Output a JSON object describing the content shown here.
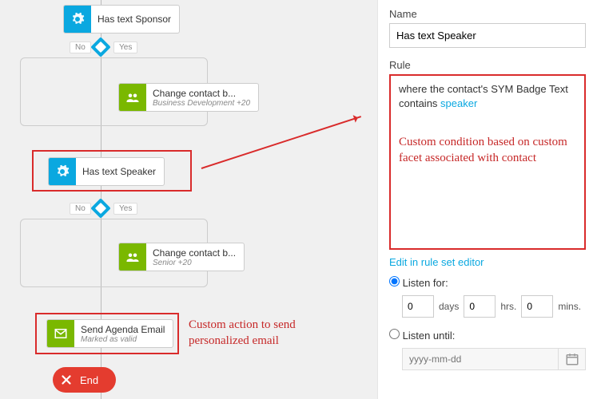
{
  "flow": {
    "sponsor": {
      "title": "Has text Sponsor"
    },
    "dec1": {
      "no": "No",
      "yes": "Yes"
    },
    "change1": {
      "title": "Change contact b...",
      "sub": "Business Development +20"
    },
    "speaker": {
      "title": "Has text Speaker"
    },
    "dec2": {
      "no": "No",
      "yes": "Yes"
    },
    "change2": {
      "title": "Change contact b...",
      "sub": "Senior +20"
    },
    "agenda": {
      "title": "Send Agenda Email",
      "sub": "Marked as valid"
    },
    "end": {
      "title": "End"
    }
  },
  "annotations": {
    "action": "Custom action to send personalized email",
    "condition": "Custom condition based on custom facet associated with contact"
  },
  "panel": {
    "name_label": "Name",
    "name_value": "Has text Speaker",
    "rule_label": "Rule",
    "rule_text_prefix": "where the contact's SYM Badge Text contains ",
    "rule_link": "speaker",
    "edit_link": "Edit in rule set editor",
    "listen_for": "Listen for:",
    "listen_until": "Listen until:",
    "dur": {
      "days": "0",
      "days_l": "days",
      "hrs": "0",
      "hrs_l": "hrs.",
      "mins": "0",
      "mins_l": "mins."
    },
    "date_placeholder": "yyyy-mm-dd"
  }
}
